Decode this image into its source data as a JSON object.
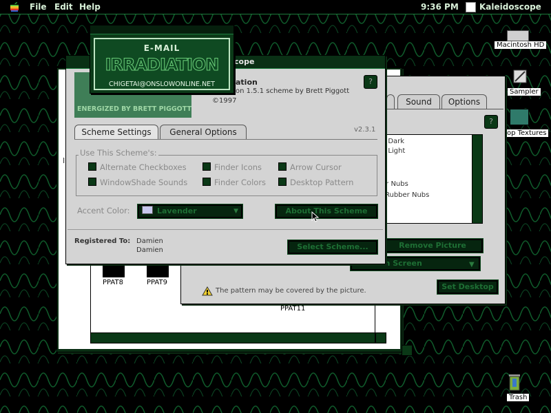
{
  "menubar": {
    "file": "File",
    "edit": "Edit",
    "help": "Help",
    "clock": "9:36 PM",
    "app": "Kaleidoscope"
  },
  "desktop_icons": {
    "hd": "Macintosh HD",
    "sampler": "Sampler",
    "textures": "op Textures",
    "trash": "Trash"
  },
  "bg_window": {
    "ppat8": "PPAT8",
    "ppat9": "PPAT9",
    "ppat11": "PPAT11",
    "stray_label": "I"
  },
  "right_window": {
    "tabs": [
      "Sound",
      "Options"
    ],
    "list_items": [
      "e Dark",
      "e Light",
      "er Nubs",
      "Rubber Nubs"
    ],
    "remove_button": "Remove Picture",
    "position_select": "on Screen",
    "set_button": "Set Desktop",
    "warning": "The pattern may be covered by the picture."
  },
  "main_window": {
    "title": "cope",
    "scheme_name": "ation",
    "scheme_desc": "on 1.5.1 scheme by Brett Piggott",
    "year": "©1997",
    "version": "v2.3.1",
    "banner_sub": "ENERGIZED BY BRETT PIGGOTT",
    "tabs": [
      "Scheme Settings",
      "General Options"
    ],
    "group_label": "Use This Scheme's:",
    "options": [
      "Alternate Checkboxes",
      "Finder Icons",
      "Arrow Cursor",
      "WindowShade Sounds",
      "Finder Colors",
      "Desktop Pattern"
    ],
    "accent_label": "Accent Color:",
    "accent_value": "Lavender",
    "about_button": "About This Scheme",
    "registered_label": "Registered To:",
    "registered_name1": "Damien",
    "registered_name2": "Damien",
    "select_button": "Select Scheme..."
  },
  "popup": {
    "email_label": "E-MAIL",
    "logo": "IRRADIATION",
    "address": "CHIGETAI@ONSLOWONLINE.NET"
  },
  "colors": {
    "accent": "#1a8a3a",
    "window": "#d4d4d4"
  }
}
